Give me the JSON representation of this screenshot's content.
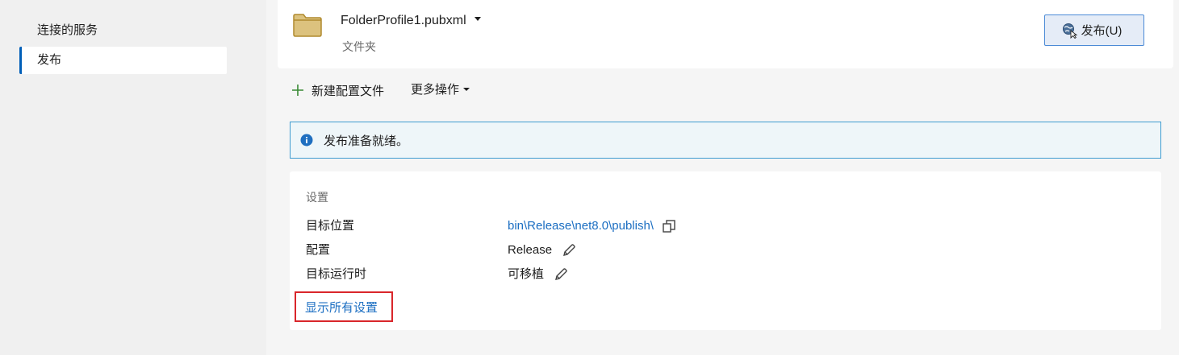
{
  "nav": {
    "items": [
      {
        "label": "连接的服务",
        "selected": false
      },
      {
        "label": "发布",
        "selected": true
      }
    ]
  },
  "header": {
    "profile_name": "FolderProfile1.pubxml",
    "profile_type": "文件夹",
    "publish_button": "发布(U)"
  },
  "toolbar": {
    "new_profile": "新建配置文件",
    "more_actions": "更多操作"
  },
  "info": {
    "message": "发布准备就绪。"
  },
  "settings": {
    "title": "设置",
    "rows": [
      {
        "label": "目标位置",
        "value": "bin\\Release\\net8.0\\publish\\",
        "action_icon": "copy-icon"
      },
      {
        "label": "配置",
        "value": "Release",
        "action_icon": "pencil-icon"
      },
      {
        "label": "目标运行时",
        "value": "可移植",
        "action_icon": "pencil-icon"
      }
    ],
    "show_all": "显示所有设置"
  },
  "colors": {
    "accent": "#005fb8",
    "link": "#1b6ec2",
    "info_border": "#3e9bd0",
    "info_bg": "#eef6f9",
    "highlight_box": "#d9262b",
    "folder": "#c8a24a"
  }
}
